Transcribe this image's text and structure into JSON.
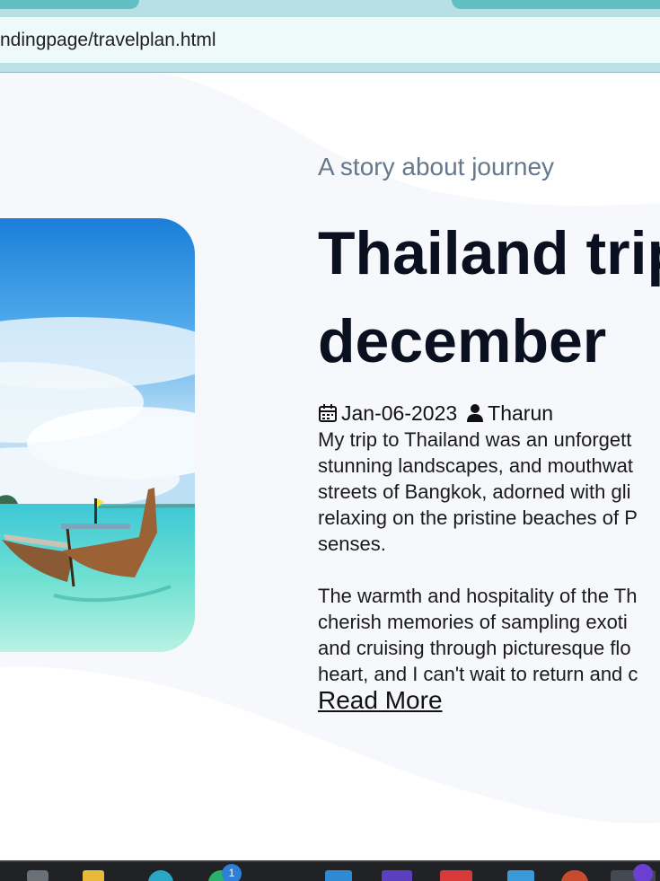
{
  "browser": {
    "url": "ndingpage/travelplan.html"
  },
  "article": {
    "kicker": "A story about journey",
    "title_line1": "Thailand trip",
    "title_line2": "december",
    "date": "Jan-06-2023",
    "author": "Tharun",
    "paragraph1": [
      "My trip to Thailand was an unforgett",
      "stunning landscapes, and mouthwat",
      "streets of Bangkok, adorned with gli",
      "relaxing on the pristine beaches of P",
      "senses."
    ],
    "paragraph2": [
      "The warmth and hospitality of the Th",
      "cherish memories of sampling exoti",
      "and cruising through picturesque flo",
      "heart, and I can't wait to return and c"
    ],
    "read_more": "Read More"
  },
  "taskbar": {
    "badge_count": "1"
  },
  "icons": {
    "calendar": "calendar-icon",
    "author": "person-icon"
  },
  "colors": {
    "kicker": "#66788a",
    "title": "#0b1020",
    "wave": "#f6f8fb",
    "tab_accent": "#5fbfc3"
  }
}
